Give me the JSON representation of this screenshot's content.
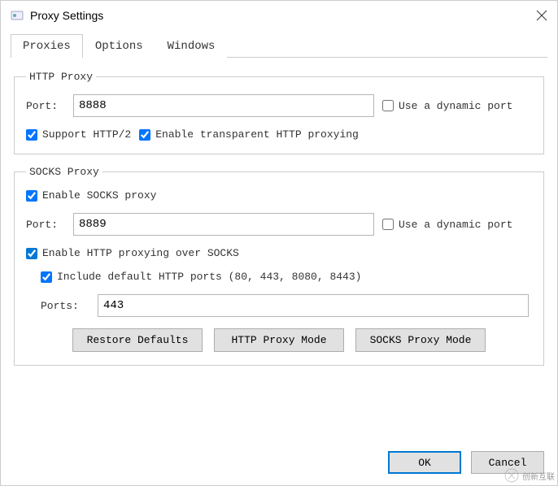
{
  "window": {
    "title": "Proxy Settings"
  },
  "tabs": [
    "Proxies",
    "Options",
    "Windows"
  ],
  "http_proxy": {
    "legend": "HTTP Proxy",
    "port_label": "Port:",
    "port_value": "8888",
    "dynamic_port_label": "Use a dynamic port",
    "dynamic_port_checked": false,
    "support_http2_label": "Support HTTP/2",
    "support_http2_checked": true,
    "enable_transparent_label": "Enable transparent HTTP proxying",
    "enable_transparent_checked": true
  },
  "socks_proxy": {
    "legend": "SOCKS Proxy",
    "enable_label": "Enable SOCKS proxy",
    "enable_checked": true,
    "port_label": "Port:",
    "port_value": "8889",
    "dynamic_port_label": "Use a dynamic port",
    "dynamic_port_checked": false,
    "enable_http_over_socks_label": "Enable HTTP proxying over SOCKS",
    "enable_http_over_socks_checked": true,
    "include_default_ports_label": "Include default HTTP ports (80, 443, 8080, 8443)",
    "include_default_ports_checked": true,
    "ports_label": "Ports:",
    "ports_value": "443"
  },
  "buttons": {
    "restore_defaults": "Restore Defaults",
    "http_proxy_mode": "HTTP Proxy Mode",
    "socks_proxy_mode": "SOCKS Proxy Mode",
    "ok": "OK",
    "cancel": "Cancel"
  },
  "watermark": "创新互联"
}
